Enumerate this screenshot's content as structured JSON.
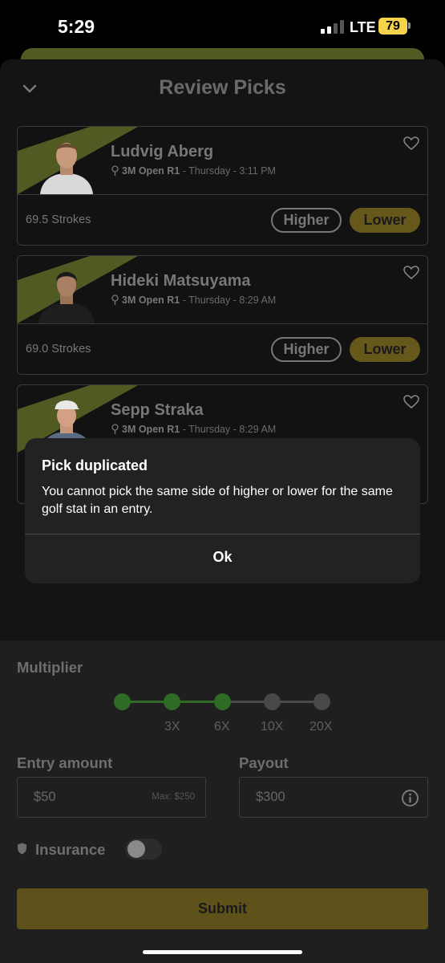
{
  "status_bar": {
    "time": "5:29",
    "network": "LTE",
    "battery": "79"
  },
  "header": {
    "title": "Review Picks"
  },
  "picks": [
    {
      "name": "Ludvig Aberg",
      "tournament": "3M Open R1",
      "time": " - Thursday - 3:11 PM",
      "stat": "69.5 Strokes",
      "higher_label": "Higher",
      "lower_label": "Lower"
    },
    {
      "name": "Hideki Matsuyama",
      "tournament": "3M Open R1",
      "time": " - Thursday - 8:29 AM",
      "stat": "69.0 Strokes",
      "higher_label": "Higher",
      "lower_label": "Lower"
    },
    {
      "name": "Sepp Straka",
      "tournament": "3M Open R1",
      "time": " - Thursday - 8:29 AM"
    }
  ],
  "dialog": {
    "title": "Pick duplicated",
    "message": "You cannot pick the same side of higher or lower for the same golf stat in an entry.",
    "ok_label": "Ok"
  },
  "multiplier": {
    "label": "Multiplier",
    "ticks": [
      "3X",
      "6X",
      "10X",
      "20X"
    ],
    "active_steps": 3,
    "total_steps": 5
  },
  "entry": {
    "label": "Entry amount",
    "value": "$50",
    "max": "Max: $250"
  },
  "payout": {
    "label": "Payout",
    "value": "$300"
  },
  "insurance": {
    "label": "Insurance",
    "enabled": false
  },
  "submit": {
    "label": "Submit"
  },
  "colors": {
    "accent_green": "#3a8a2e",
    "accent_gold": "#66581b",
    "stripe": "#525a23"
  }
}
